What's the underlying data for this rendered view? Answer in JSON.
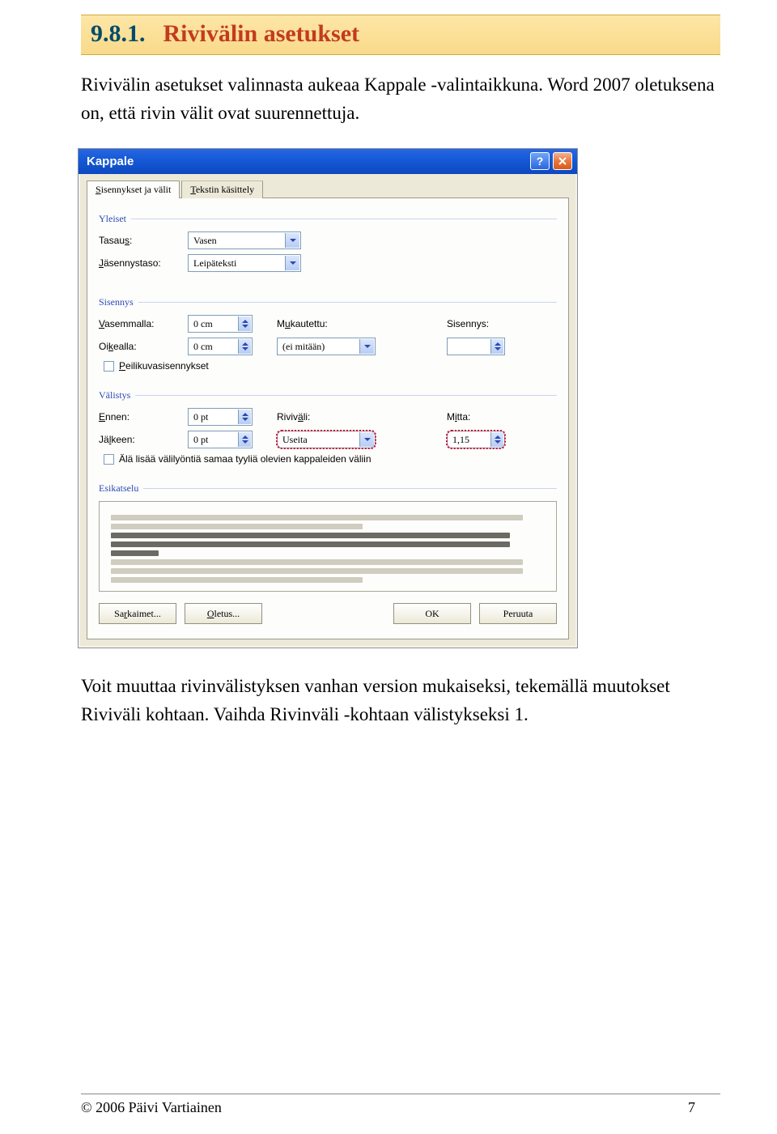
{
  "heading": {
    "number": "9.8.1.",
    "title": "Rivivälin asetukset"
  },
  "intro": "Rivivälin asetukset valinnasta aukeaa Kappale -valintaikkuna. Word 2007 oletuksena on, että rivin välit ovat suurennettuja.",
  "dialog": {
    "title": "Kappale",
    "tabs": {
      "active": "Sisennykset ja välit",
      "inactive": "Tekstin käsittely"
    },
    "group_general": "Yleiset",
    "labels": {
      "tasaus": "Tasaus:",
      "jasennys": "Jäsennystaso:",
      "vasemmalla": "Vasemmalla:",
      "oikealla": "Oikealla:",
      "mukautettu": "Mukautettu:",
      "sisennys": "Sisennys:",
      "ennen": "Ennen:",
      "jalkeen": "Jälkeen:",
      "rivivali": "Riviväli:",
      "mitta": "Mitta:"
    },
    "values": {
      "tasaus": "Vasen",
      "jasennys": "Leipäteksti",
      "vasemmalla": "0 cm",
      "oikealla": "0 cm",
      "mukautettu": "(ei mitään)",
      "ennen": "0 pt",
      "jalkeen": "0 pt",
      "rivivali": "Useita",
      "mitta": "1,15"
    },
    "group_indent": "Sisennys",
    "peilikuva": "Peilikuvasisennykset",
    "group_spacing": "Välistys",
    "ala_lisaa": "Älä lisää välilyöntiä samaa tyyliä olevien kappaleiden väliin",
    "group_preview": "Esikatselu",
    "buttons": {
      "sarkaimet": "Sarkaimet...",
      "oletus": "Oletus...",
      "ok": "OK",
      "peruuta": "Peruuta"
    }
  },
  "outro": "Voit muuttaa rivinvälistyksen vanhan version mukaiseksi, tekemällä muutokset Riviväli kohtaan. Vaihda Rivinväli -kohtaan välistykseksi 1.",
  "footer": {
    "copyright": "© 2006 Päivi Vartiainen",
    "page": "7"
  }
}
